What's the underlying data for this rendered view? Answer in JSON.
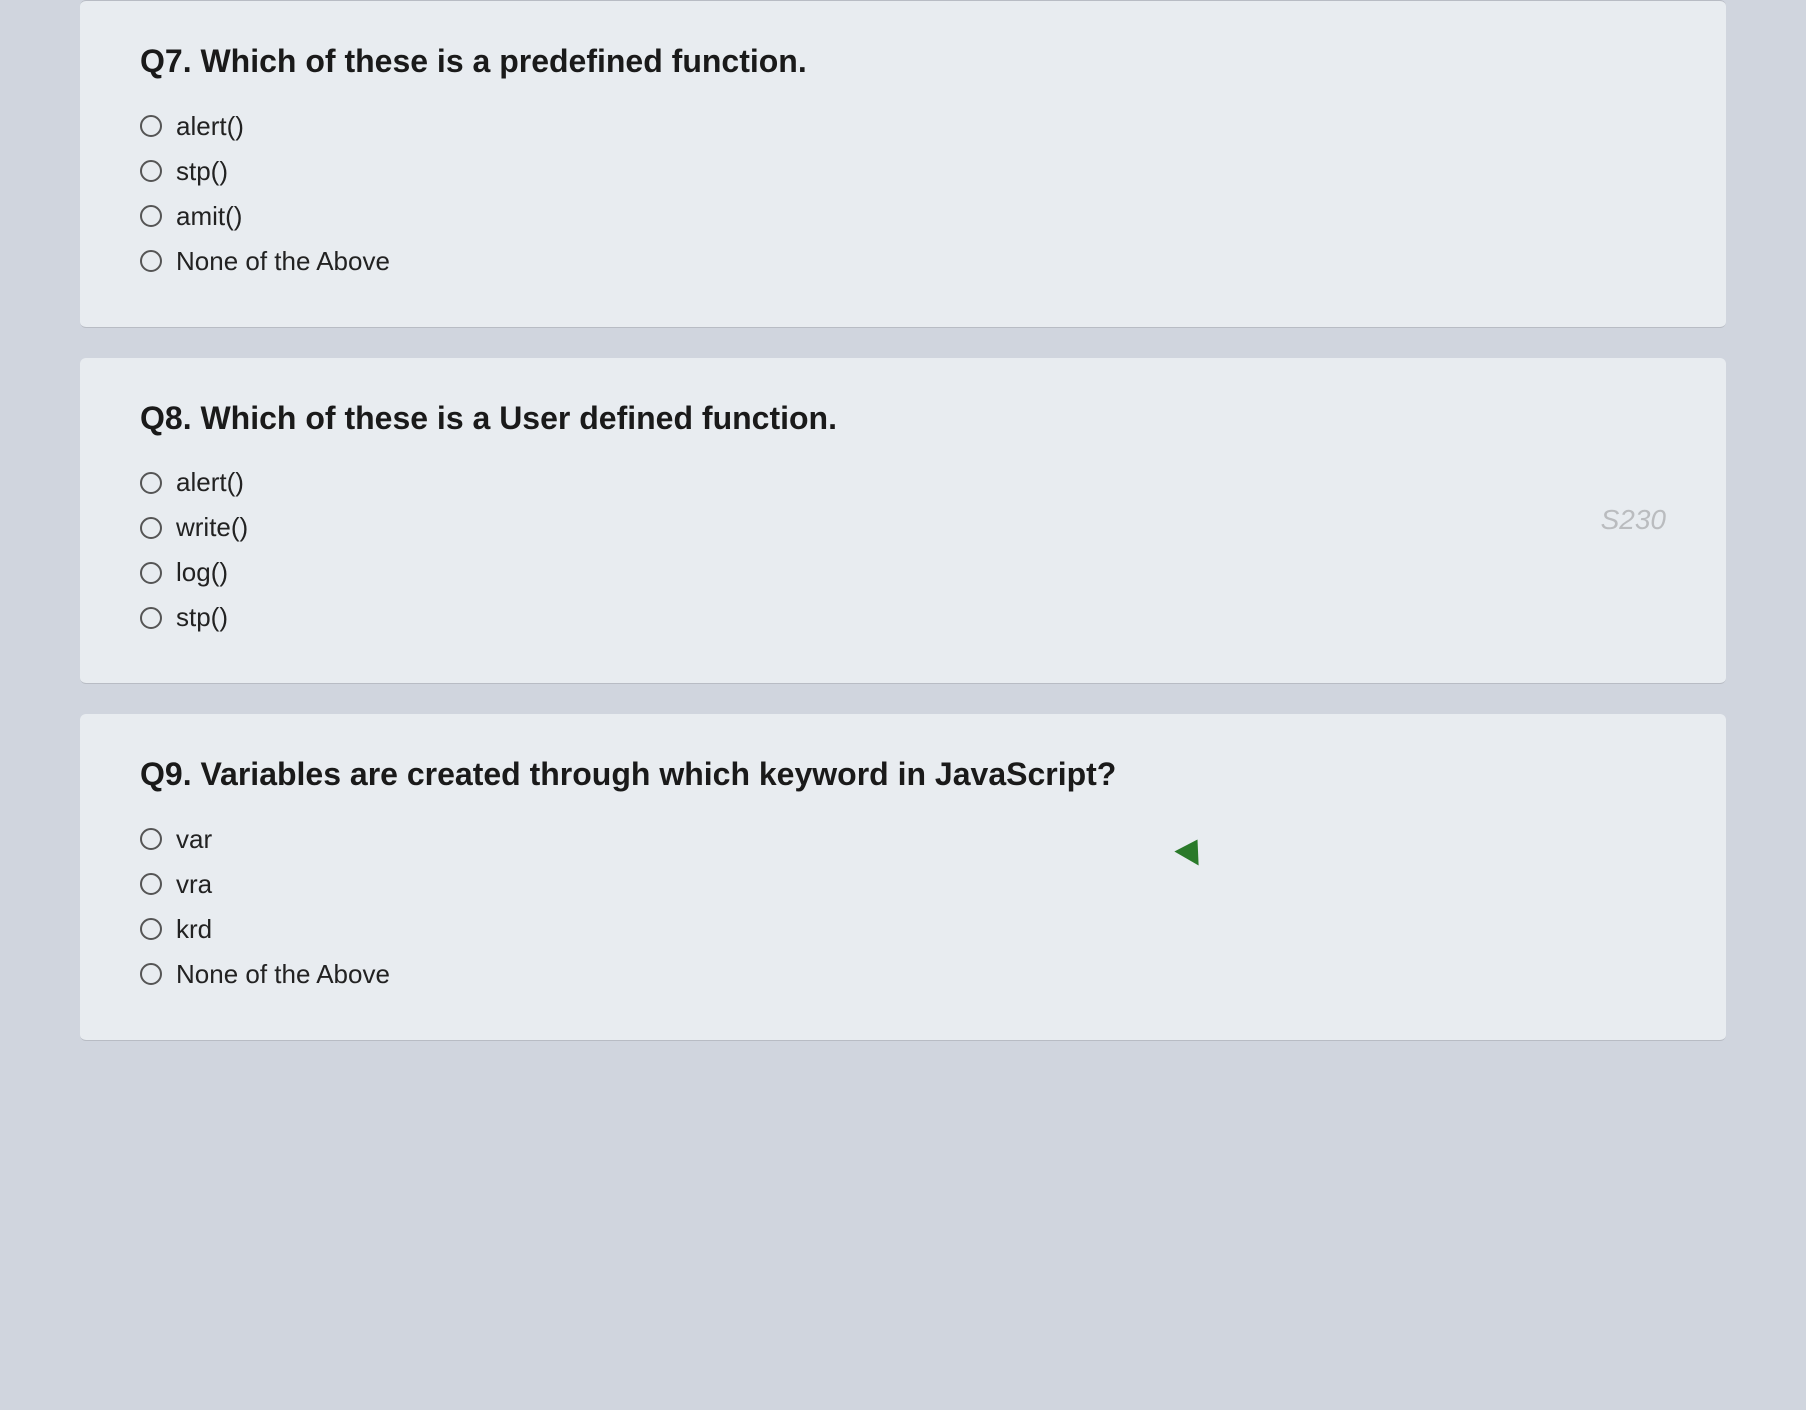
{
  "questions": [
    {
      "id": "q7",
      "title": "Q7. Which of these is a predefined function.",
      "options": [
        {
          "id": "q7_a",
          "label": "alert()"
        },
        {
          "id": "q7_b",
          "label": "stp()"
        },
        {
          "id": "q7_c",
          "label": "amit()"
        },
        {
          "id": "q7_d",
          "label": "None of the Above"
        }
      ],
      "watermark": null
    },
    {
      "id": "q8",
      "title": "Q8. Which of these is a User defined function.",
      "options": [
        {
          "id": "q8_a",
          "label": "alert()"
        },
        {
          "id": "q8_b",
          "label": "write()"
        },
        {
          "id": "q8_c",
          "label": "log()"
        },
        {
          "id": "q8_d",
          "label": "stp()"
        }
      ],
      "watermark": "S230"
    },
    {
      "id": "q9",
      "title": "Q9. Variables are created through which keyword in JavaScript?",
      "options": [
        {
          "id": "q9_a",
          "label": "var"
        },
        {
          "id": "q9_b",
          "label": "vra"
        },
        {
          "id": "q9_c",
          "label": "krd"
        },
        {
          "id": "q9_d",
          "label": "None of the Above"
        }
      ],
      "watermark": null
    }
  ]
}
